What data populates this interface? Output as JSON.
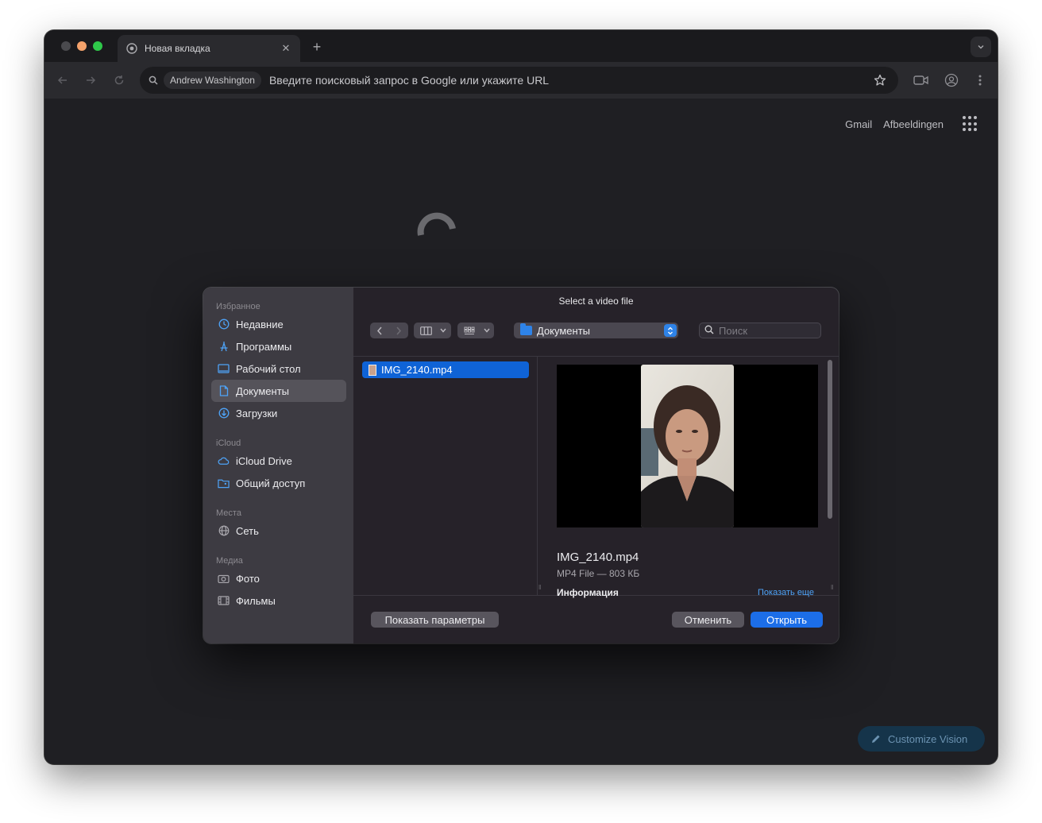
{
  "browser": {
    "tab_title": "Новая вкладка",
    "omnibox_chip": "Andrew Washington",
    "omnibox_placeholder": "Введите поисковый запрос в Google или укажите URL"
  },
  "newtab_page": {
    "links": [
      "Gmail",
      "Afbeeldingen"
    ],
    "customize_label": "Customize Vision"
  },
  "dialog": {
    "title": "Select a video file",
    "sidebar": {
      "sections": [
        {
          "label": "Избранное",
          "items": [
            {
              "label": "Недавние",
              "icon": "clock-icon"
            },
            {
              "label": "Программы",
              "icon": "apps-icon"
            },
            {
              "label": "Рабочий стол",
              "icon": "desktop-icon"
            },
            {
              "label": "Документы",
              "icon": "document-icon",
              "selected": true
            },
            {
              "label": "Загрузки",
              "icon": "download-icon"
            }
          ]
        },
        {
          "label": "iCloud",
          "items": [
            {
              "label": "iCloud Drive",
              "icon": "cloud-icon"
            },
            {
              "label": "Общий доступ",
              "icon": "shared-folder-icon"
            }
          ]
        },
        {
          "label": "Места",
          "items": [
            {
              "label": "Сеть",
              "icon": "globe-icon"
            }
          ]
        },
        {
          "label": "Медиа",
          "items": [
            {
              "label": "Фото",
              "icon": "camera-icon"
            },
            {
              "label": "Фильмы",
              "icon": "film-icon"
            }
          ]
        }
      ]
    },
    "location": "Документы",
    "search_placeholder": "Поиск",
    "files": [
      {
        "name": "IMG_2140.mp4",
        "selected": true
      }
    ],
    "preview": {
      "name": "IMG_2140.mp4",
      "meta": "MP4 File — 803 КБ",
      "info_label": "Информация",
      "more_label": "Показать еще"
    },
    "buttons": {
      "options": "Показать параметры",
      "cancel": "Отменить",
      "open": "Открыть"
    }
  },
  "colors": {
    "accent": "#1c6ee8",
    "sidebar_icon": "#4ea3f7",
    "selection": "#0f63d6"
  }
}
